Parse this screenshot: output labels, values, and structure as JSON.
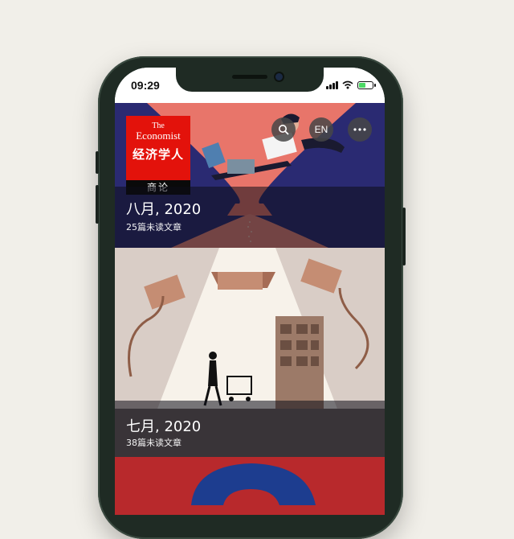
{
  "status_bar": {
    "time": "09:29"
  },
  "brand": {
    "line1": "The",
    "line2": "Economist",
    "chinese_name": "经济学人",
    "section": "商论",
    "color": "#e3120b"
  },
  "header_actions": {
    "search_icon": "search-icon",
    "language_label": "EN",
    "more_icon": "more-icon"
  },
  "issues": [
    {
      "title": "八月, 2020",
      "unread": "25篇未读文章",
      "cover_color": "#2a2a72"
    },
    {
      "title": "七月, 2020",
      "unread": "38篇未读文章",
      "cover_color": "#d9cdc6"
    },
    {
      "cover_color": "#b8292c"
    }
  ]
}
